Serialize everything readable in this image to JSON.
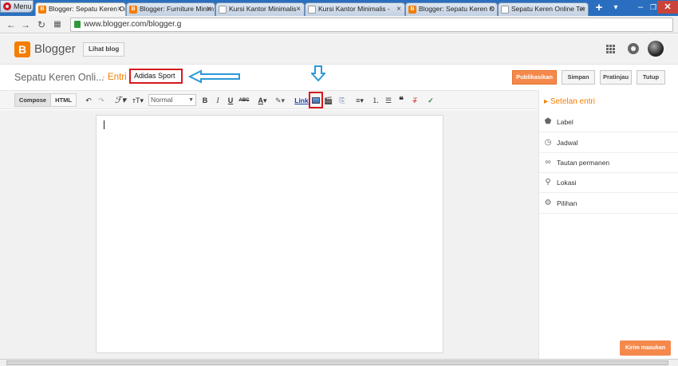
{
  "browser": {
    "menu_label": "Menu",
    "tabs": [
      {
        "label": "Blogger: Sepatu Keren On",
        "active": true,
        "favicon": "blogger-icon"
      },
      {
        "label": "Blogger: Furniture Minim",
        "active": false,
        "favicon": "blogger-icon"
      },
      {
        "label": "Kursi Kantor Minimalis -",
        "active": false,
        "favicon": "page-icon"
      },
      {
        "label": "Kursi Kantor Minimalis -",
        "active": false,
        "favicon": "page-icon"
      },
      {
        "label": "Blogger: Sepatu Keren O",
        "active": false,
        "favicon": "blogger-icon"
      },
      {
        "label": "Sepatu Keren Online Ter",
        "active": false,
        "favicon": "page-icon"
      }
    ],
    "close_glyph": "×",
    "new_tab_glyph": "+",
    "url": "www.blogger.com/blogger.g",
    "window_controls": {
      "minimize": "–",
      "maximize": "❐",
      "close": "✕"
    }
  },
  "header": {
    "logo_letter": "B",
    "brand": "Blogger",
    "view_blog": "Lihat blog"
  },
  "post": {
    "blog_title": "Sepatu Keren Onli...",
    "entry_label": "· Entri",
    "title_value": "Adidas Sport",
    "publish": "Publikasikan",
    "save": "Simpan",
    "preview": "Pratinjau",
    "close": "Tutup"
  },
  "toolbar": {
    "compose": "Compose",
    "html": "HTML",
    "font_size": "Normal",
    "bold": "B",
    "italic": "I",
    "underline": "U",
    "strike": "ABC",
    "link": "Link"
  },
  "sidebar": {
    "heading": "Setelan entri",
    "items": [
      {
        "label": "Label",
        "icon": "tag-icon"
      },
      {
        "label": "Jadwal",
        "icon": "clock-icon"
      },
      {
        "label": "Tautan permanen",
        "icon": "link-icon"
      },
      {
        "label": "Lokasi",
        "icon": "location-icon"
      },
      {
        "label": "Pilihan",
        "icon": "gear-icon"
      }
    ]
  },
  "feedback": "Kirim masukan",
  "colors": {
    "accent": "#f57d00",
    "publish": "#f5894b",
    "highlight": "#d6191b",
    "annotation_arrow": "#2a9ad8"
  }
}
